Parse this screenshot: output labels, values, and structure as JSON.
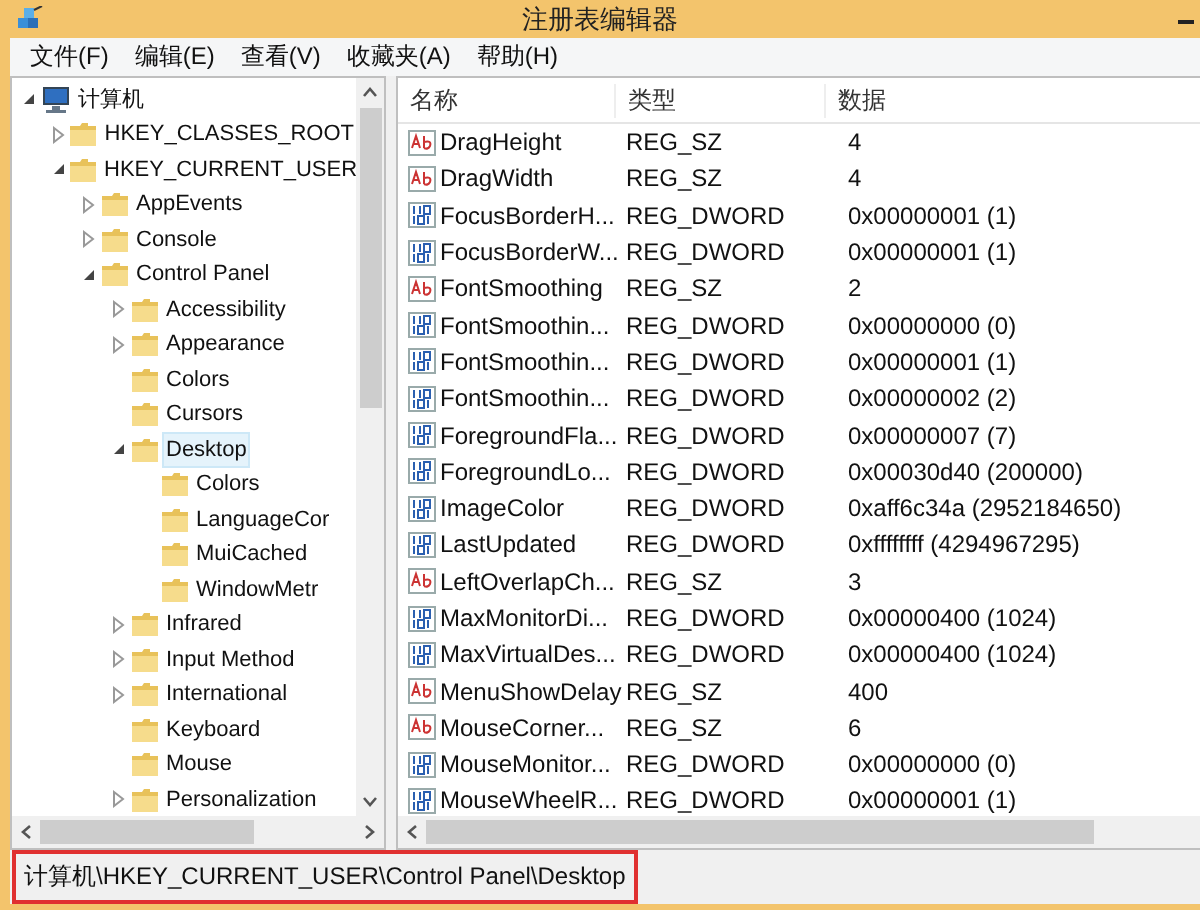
{
  "window": {
    "title": "注册表编辑器"
  },
  "menu": [
    "文件(F)",
    "编辑(E)",
    "查看(V)",
    "收藏夹(A)",
    "帮助(H)"
  ],
  "tree": [
    {
      "label": "计算机",
      "kind": "computer",
      "expanded": true,
      "selected": false,
      "children": [
        {
          "label": "HKEY_CLASSES_ROOT",
          "expanded": false,
          "selected": false
        },
        {
          "label": "HKEY_CURRENT_USER",
          "expanded": true,
          "selected": false,
          "children": [
            {
              "label": "AppEvents",
              "expanded": false,
              "selected": false
            },
            {
              "label": "Console",
              "expanded": false,
              "selected": false
            },
            {
              "label": "Control Panel",
              "expanded": true,
              "selected": false,
              "children": [
                {
                  "label": "Accessibility",
                  "expanded": false,
                  "selected": false
                },
                {
                  "label": "Appearance",
                  "expanded": false,
                  "selected": false
                },
                {
                  "label": "Colors",
                  "selected": false
                },
                {
                  "label": "Cursors",
                  "selected": false
                },
                {
                  "label": "Desktop",
                  "expanded": true,
                  "selected": true,
                  "children": [
                    {
                      "label": "Colors",
                      "selected": false
                    },
                    {
                      "label": "LanguageCor",
                      "selected": false
                    },
                    {
                      "label": "MuiCached",
                      "selected": false
                    },
                    {
                      "label": "WindowMetr",
                      "selected": false
                    }
                  ]
                },
                {
                  "label": "Infrared",
                  "expanded": false,
                  "selected": false
                },
                {
                  "label": "Input Method",
                  "expanded": false,
                  "selected": false
                },
                {
                  "label": "International",
                  "expanded": false,
                  "selected": false
                },
                {
                  "label": "Keyboard",
                  "selected": false
                },
                {
                  "label": "Mouse",
                  "selected": false
                },
                {
                  "label": "Personalization",
                  "expanded": false,
                  "selected": false
                }
              ]
            }
          ]
        }
      ]
    }
  ],
  "table": {
    "columns": [
      "名称",
      "类型",
      "数据"
    ],
    "rows": [
      {
        "kind": "string",
        "name": "DragHeight",
        "type": "REG_SZ",
        "data": "4"
      },
      {
        "kind": "string",
        "name": "DragWidth",
        "type": "REG_SZ",
        "data": "4"
      },
      {
        "kind": "dword",
        "name": "FocusBorderH...",
        "type": "REG_DWORD",
        "data": "0x00000001 (1)"
      },
      {
        "kind": "dword",
        "name": "FocusBorderW...",
        "type": "REG_DWORD",
        "data": "0x00000001 (1)"
      },
      {
        "kind": "string",
        "name": "FontSmoothing",
        "type": "REG_SZ",
        "data": "2"
      },
      {
        "kind": "dword",
        "name": "FontSmoothin...",
        "type": "REG_DWORD",
        "data": "0x00000000 (0)"
      },
      {
        "kind": "dword",
        "name": "FontSmoothin...",
        "type": "REG_DWORD",
        "data": "0x00000001 (1)"
      },
      {
        "kind": "dword",
        "name": "FontSmoothin...",
        "type": "REG_DWORD",
        "data": "0x00000002 (2)"
      },
      {
        "kind": "dword",
        "name": "ForegroundFla...",
        "type": "REG_DWORD",
        "data": "0x00000007 (7)"
      },
      {
        "kind": "dword",
        "name": "ForegroundLo...",
        "type": "REG_DWORD",
        "data": "0x00030d40 (200000)"
      },
      {
        "kind": "dword",
        "name": "ImageColor",
        "type": "REG_DWORD",
        "data": "0xaff6c34a (2952184650)"
      },
      {
        "kind": "dword",
        "name": "LastUpdated",
        "type": "REG_DWORD",
        "data": "0xffffffff (4294967295)"
      },
      {
        "kind": "string",
        "name": "LeftOverlapCh...",
        "type": "REG_SZ",
        "data": "3"
      },
      {
        "kind": "dword",
        "name": "MaxMonitorDi...",
        "type": "REG_DWORD",
        "data": "0x00000400 (1024)"
      },
      {
        "kind": "dword",
        "name": "MaxVirtualDes...",
        "type": "REG_DWORD",
        "data": "0x00000400 (1024)"
      },
      {
        "kind": "string",
        "name": "MenuShowDelay",
        "type": "REG_SZ",
        "data": "400"
      },
      {
        "kind": "string",
        "name": "MouseCorner...",
        "type": "REG_SZ",
        "data": "6"
      },
      {
        "kind": "dword",
        "name": "MouseMonitor...",
        "type": "REG_DWORD",
        "data": "0x00000000 (0)"
      },
      {
        "kind": "dword",
        "name": "MouseWheelR...",
        "type": "REG_DWORD",
        "data": "0x00000001 (1)"
      }
    ]
  },
  "status_bar": {
    "text": "计算机\\HKEY_CURRENT_USER\\Control Panel\\Desktop",
    "highlighted": true
  }
}
